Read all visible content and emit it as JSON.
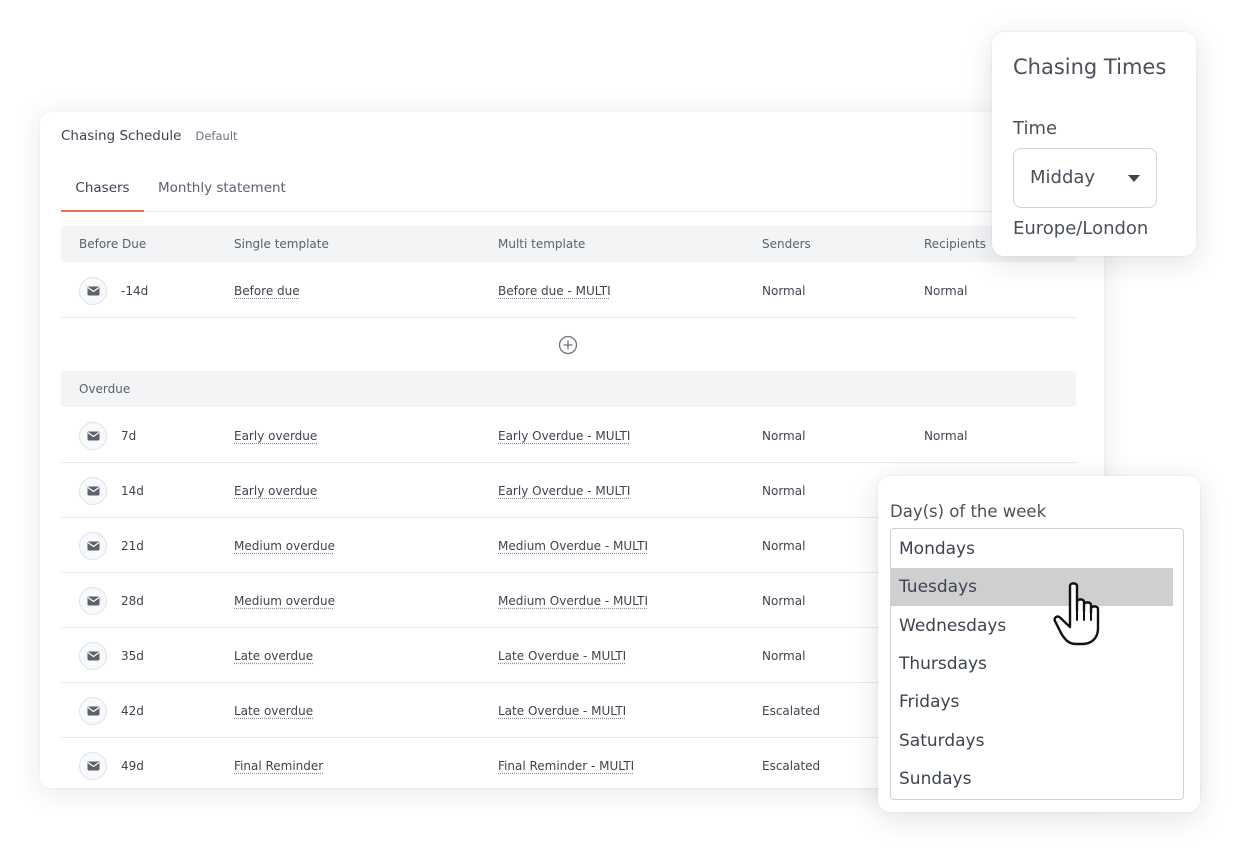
{
  "schedule": {
    "title": "Chasing Schedule",
    "badge": "Default",
    "tabs": [
      {
        "label": "Chasers",
        "active": true
      },
      {
        "label": "Monthly statement",
        "active": false
      }
    ],
    "columns": [
      "Before Due",
      "Single template",
      "Multi template",
      "Senders",
      "Recipients"
    ],
    "before_due_rows": [
      {
        "days": "-14d",
        "single": "Before due",
        "multi": "Before due - MULTI",
        "senders": "Normal",
        "recipients": "Normal"
      }
    ],
    "overdue_label": "Overdue",
    "overdue_rows": [
      {
        "days": "7d",
        "single": "Early overdue",
        "multi": "Early Overdue - MULTI",
        "senders": "Normal",
        "recipients": "Normal"
      },
      {
        "days": "14d",
        "single": "Early overdue",
        "multi": "Early Overdue - MULTI",
        "senders": "Normal",
        "recipients": ""
      },
      {
        "days": "21d",
        "single": "Medium overdue",
        "multi": "Medium Overdue - MULTI",
        "senders": "Normal",
        "recipients": ""
      },
      {
        "days": "28d",
        "single": "Medium overdue",
        "multi": "Medium Overdue - MULTI",
        "senders": "Normal",
        "recipients": ""
      },
      {
        "days": "35d",
        "single": "Late overdue",
        "multi": "Late Overdue - MULTI",
        "senders": "Normal",
        "recipients": ""
      },
      {
        "days": "42d",
        "single": "Late overdue",
        "multi": "Late Overdue - MULTI",
        "senders": "Escalated",
        "recipients": ""
      },
      {
        "days": "49d",
        "single": "Final Reminder",
        "multi": "Final Reminder - MULTI",
        "senders": "Escalated",
        "recipients": ""
      }
    ],
    "add_icon": "plus-circle-icon",
    "row_icon": "mail-icon"
  },
  "chasing_times": {
    "title": "Chasing Times",
    "time_label": "Time",
    "time_value": "Midday",
    "timezone": "Europe/London"
  },
  "days_of_week": {
    "label": "Day(s) of the week",
    "options": [
      "Mondays",
      "Tuesdays",
      "Wednesdays",
      "Thursdays",
      "Fridays",
      "Saturdays",
      "Sundays"
    ],
    "highlighted": "Tuesdays"
  },
  "colors": {
    "accent": "#e8734f",
    "highlight": "#cfcfcf",
    "section_bg": "#f3f4f6"
  }
}
